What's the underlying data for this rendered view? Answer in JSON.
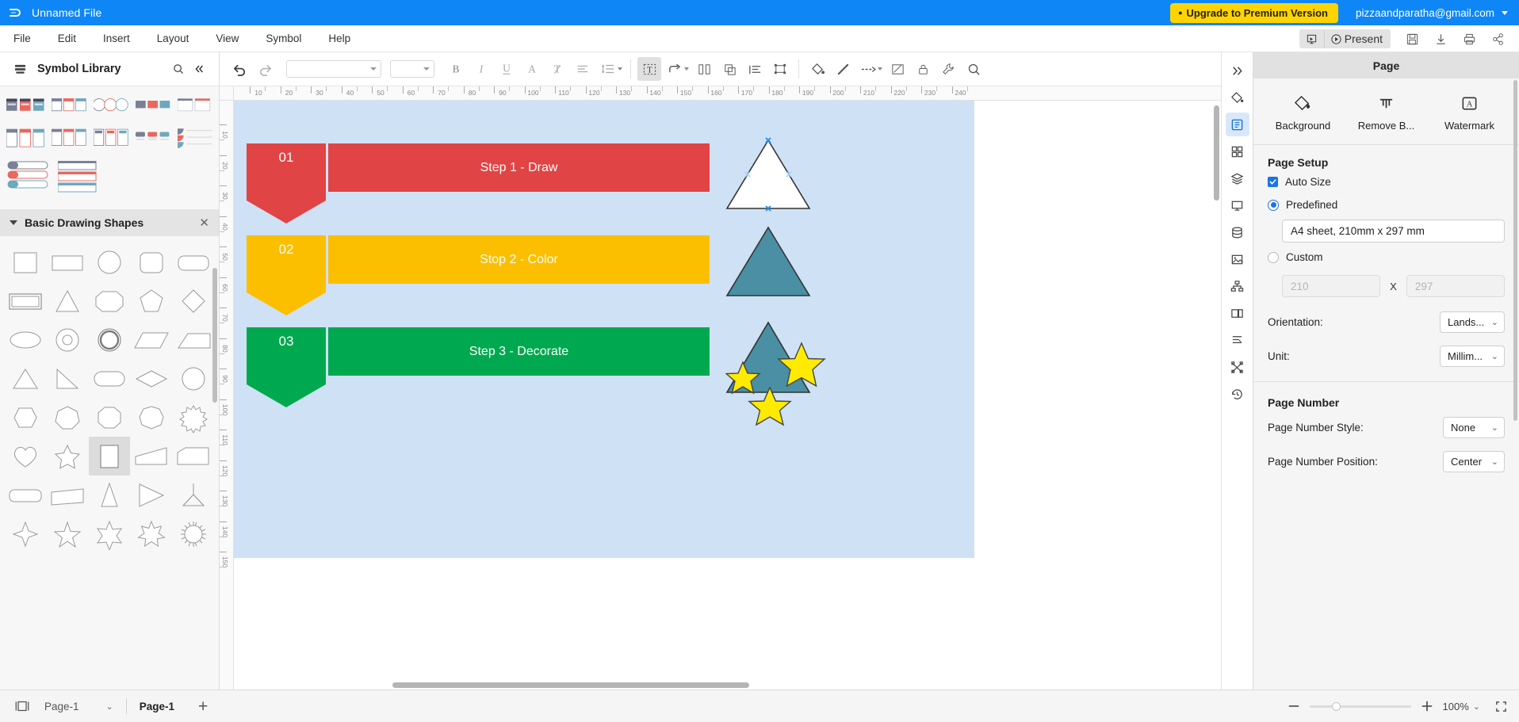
{
  "titlebar": {
    "logo_icon": "edraw-logo-icon",
    "file_name": "Unnamed File",
    "upgrade_label": "Upgrade to Premium Version",
    "account_email": "pizzaandparatha@gmail.com"
  },
  "menubar": {
    "items": [
      "File",
      "Edit",
      "Insert",
      "Layout",
      "View",
      "Symbol",
      "Help"
    ],
    "present_label": "Present",
    "right_icons": [
      "presentation-mode-icon",
      "save-icon",
      "download-icon",
      "print-icon",
      "share-icon"
    ]
  },
  "toolbar": {
    "undo_icon": "undo-icon",
    "redo_icon": "redo-icon",
    "font_family_value": "",
    "font_size_value": "",
    "buttons": [
      {
        "name": "bold-button",
        "glyph": "B"
      },
      {
        "name": "italic-button",
        "glyph": "I"
      },
      {
        "name": "underline-button",
        "glyph": "U"
      },
      {
        "name": "font-color-button",
        "glyph": "A"
      },
      {
        "name": "clear-format-button",
        "glyph": "T"
      }
    ],
    "icons": [
      "align-text-icon",
      "line-spacing-icon",
      "text-box-icon",
      "connector-icon",
      "align-objects-icon",
      "distribute-icon",
      "order-icon",
      "group-icon",
      "fill-color-icon",
      "line-color-icon",
      "line-style-icon",
      "edit-shape-icon",
      "lock-icon",
      "tools-icon",
      "search-icon"
    ]
  },
  "left_panel": {
    "header_title": "Symbol Library",
    "header_icons": [
      "library-icon",
      "search-icon",
      "collapse-icon"
    ],
    "section_title": "Basic Drawing Shapes",
    "close_icon": "close-icon",
    "shapes": [
      "square",
      "rectangle",
      "circle",
      "rounded-square",
      "rounded-rectangle",
      "double-rectangle",
      "triangle",
      "octagon",
      "pentagon",
      "diamond",
      "ellipse",
      "donut",
      "ring",
      "parallelogram",
      "trapezoid",
      "right-triangle",
      "right-triangle-2",
      "rounded-pill",
      "diamond-2",
      "teardrop",
      "hexagon",
      "heptagon",
      "octagon-2",
      "nonagon",
      "star-burst",
      "heart",
      "star-5",
      "frame",
      "trapezoid-2",
      "trapezoid-3",
      "rounded-bar",
      "slanted-rect",
      "narrow-triangle",
      "flag-triangle",
      "arrow-triple",
      "star-4",
      "star-5b",
      "star-6",
      "star-7",
      "sun-burst"
    ]
  },
  "canvas": {
    "ruler_h_labels": [
      10,
      20,
      30,
      40,
      50,
      60,
      70,
      80,
      90,
      100,
      110,
      120,
      130,
      140,
      150,
      160,
      170,
      180,
      190,
      200,
      210,
      220,
      230,
      240
    ],
    "ruler_v_labels": [
      10,
      20,
      30,
      40,
      50,
      60,
      70,
      80,
      90,
      100,
      110,
      120,
      130,
      140,
      150
    ],
    "page_background": "#cfe1f5",
    "banners": [
      {
        "number": "01",
        "label": "Step 1 - Draw",
        "color": "#e04444"
      },
      {
        "number": "02",
        "label": "Stop 2 - Color",
        "color": "#fbbf00"
      },
      {
        "number": "03",
        "label": "Step 3 - Decorate",
        "color": "#00a94f"
      }
    ],
    "shapes": [
      {
        "name": "triangle-white",
        "fill": "#ffffff",
        "stroke": "#333333",
        "selected": true
      },
      {
        "name": "triangle-teal-1",
        "fill": "#4a8fa3",
        "stroke": "#333333",
        "selected": false
      },
      {
        "name": "triangle-teal-2",
        "fill": "#4a8fa3",
        "stroke": "#333333",
        "selected": false
      },
      {
        "name": "star-yellow-left",
        "fill": "#ffeb00",
        "stroke": "#444444"
      },
      {
        "name": "star-yellow-right",
        "fill": "#ffeb00",
        "stroke": "#444444"
      },
      {
        "name": "star-yellow-bottom",
        "fill": "#ffeb00",
        "stroke": "#444444"
      }
    ]
  },
  "rail": {
    "icons": [
      "expand-panel-icon",
      "fill-bucket-icon",
      "page-setup-icon",
      "symbols-grid-icon",
      "layers-icon",
      "slide-icon",
      "database-icon",
      "image-icon",
      "org-chart-icon",
      "gallery-icon",
      "list-icon",
      "shuffle-icon",
      "history-icon"
    ],
    "active_index": 2
  },
  "right_panel": {
    "title": "Page",
    "tools": [
      {
        "name": "background-tool",
        "icon": "fill-bucket-icon",
        "label": "Background"
      },
      {
        "name": "remove-background-tool",
        "icon": "remove-background-icon",
        "label": "Remove B..."
      },
      {
        "name": "watermark-tool",
        "icon": "watermark-icon",
        "label": "Watermark"
      }
    ],
    "page_setup": {
      "section_title": "Page Setup",
      "auto_size_label": "Auto Size",
      "auto_size_checked": true,
      "predefined_label": "Predefined",
      "predefined_selected": true,
      "predefined_value": "A4 sheet, 210mm x 297 mm",
      "custom_label": "Custom",
      "custom_selected": false,
      "custom_width_placeholder": "210",
      "custom_x": "X",
      "custom_height_placeholder": "297",
      "orientation_label": "Orientation:",
      "orientation_value": "Lands...",
      "unit_label": "Unit:",
      "unit_value": "Millim..."
    },
    "page_number": {
      "section_title": "Page Number",
      "style_label": "Page Number Style:",
      "style_value": "None",
      "position_label": "Page Number Position:",
      "position_value": "Center"
    }
  },
  "status_bar": {
    "layout_icon": "page-layout-icon",
    "page_selector": "Page-1",
    "active_tab": "Page-1",
    "add_page_icon": "plus-icon",
    "zoom_minus": "minus-icon",
    "zoom_plus": "plus-icon",
    "zoom_value": "100%",
    "fullscreen_icon": "fullscreen-icon"
  }
}
